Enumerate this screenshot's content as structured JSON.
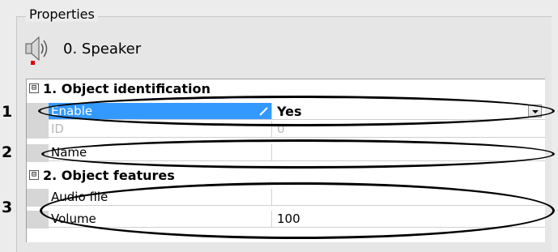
{
  "window": {
    "group_title": "Properties"
  },
  "object": {
    "label": "0. Speaker",
    "icon": "speaker-icon"
  },
  "categories": [
    {
      "toggle": "⊟",
      "title": "1. Object identification"
    },
    {
      "toggle": "⊟",
      "title": "2. Object features"
    }
  ],
  "properties": {
    "enable": {
      "name": "Enable",
      "value": "Yes"
    },
    "id": {
      "name": "ID",
      "value": "0"
    },
    "name": {
      "name": "Name",
      "value": ""
    },
    "audio_file": {
      "name": "Audio file",
      "value": ""
    },
    "volume": {
      "name": "Volume",
      "value": "100"
    }
  },
  "callouts": [
    "1",
    "2",
    "3"
  ],
  "colors": {
    "selection": "#3399ff",
    "disabled_text": "#b8b8b8",
    "status_dot": "#e00000"
  }
}
